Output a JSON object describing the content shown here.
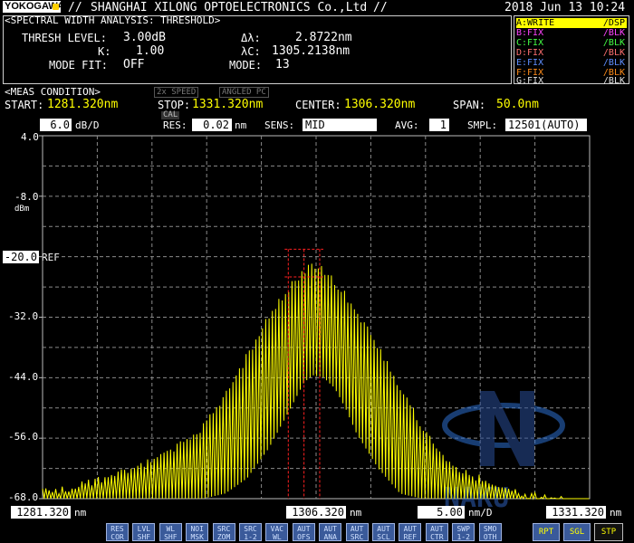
{
  "header": {
    "brand": "YOKOGAWA",
    "separator": "//",
    "company": "SHANGHAI XILONG OPTOELECTRONICS Co.,Ltd",
    "separator_end": "//",
    "datetime": "2018 Jun 13 10:24"
  },
  "analysis": {
    "title": "<SPECTRAL WIDTH ANALYSIS: THRESHOLD>",
    "thresh_label": "THRESH LEVEL:",
    "thresh_value": "3.00dB",
    "k_label": "K:",
    "k_value": "1.00",
    "mode_fit_label": "MODE FIT:",
    "mode_fit_value": "OFF",
    "dl_label": "Δλ:",
    "dl_value": "2.8722nm",
    "lc_label": "λC:",
    "lc_value": "1305.2138nm",
    "mode_label": "MODE:",
    "mode_value": "13"
  },
  "traces": [
    {
      "name": "A:WRITE",
      "state": "/DSP",
      "color": "#ffff00"
    },
    {
      "name": "B:FIX",
      "state": "/BLK",
      "color": "#ff44ff"
    },
    {
      "name": "C:FIX",
      "state": "/BLK",
      "color": "#44ff44"
    },
    {
      "name": "D:FIX",
      "state": "/BLK",
      "color": "#ff7070"
    },
    {
      "name": "E:FIX",
      "state": "/BLK",
      "color": "#5f8fff"
    },
    {
      "name": "F:FIX",
      "state": "/BLK",
      "color": "#ff8c1a"
    },
    {
      "name": "G:FIX",
      "state": "/BLK",
      "color": "#e0e0e0"
    }
  ],
  "meas": {
    "title": "<MEAS CONDITION>",
    "speed": "2x SPEED",
    "angled": "ANGLED PC",
    "start_label": "START:",
    "start_value": "1281.320nm",
    "stop_label": "STOP:",
    "stop_value": "1331.320nm",
    "center_label": "CENTER:",
    "center_value": "1306.320nm",
    "span_label": "SPAN:",
    "span_value": "50.0nm"
  },
  "settings": {
    "scale_value": "6.0",
    "scale_unit": "dB/D",
    "cal_label": "CAL",
    "res_label": "RES:",
    "res_value": "0.02",
    "res_unit": "nm",
    "sens_label": "SENS:",
    "sens_value": "MID",
    "avg_label": "AVG:",
    "avg_value": "1",
    "smpl_label": "SMPL:",
    "smpl_value": "12501(AUTO)"
  },
  "axis": {
    "y_unit": "dBm",
    "ref_value": "-20.0",
    "ref_label": "REF",
    "y_ticks": [
      "4.0",
      "-8.0",
      "-20.0",
      "-32.0",
      "-44.0",
      "-56.0",
      "-68.0"
    ],
    "x_start": "1281.320",
    "x_center": "1306.320",
    "x_stop": "1331.320",
    "x_unit": "nm",
    "x_div_value": "5.00",
    "x_div_unit": "nm/D"
  },
  "softkeys": [
    {
      "l1": "RES",
      "l2": "COR"
    },
    {
      "l1": "LVL",
      "l2": "SHF"
    },
    {
      "l1": "WL",
      "l2": "SHF"
    },
    {
      "l1": "NOI",
      "l2": "MSK"
    },
    {
      "l1": "SRC",
      "l2": "ZOM"
    },
    {
      "l1": "SRC",
      "l2": "1-2"
    },
    {
      "l1": "VAC",
      "l2": "WL"
    },
    {
      "l1": "AUT",
      "l2": "OFS"
    },
    {
      "l1": "AUT",
      "l2": "ANA"
    },
    {
      "l1": "AUT",
      "l2": "SRC"
    },
    {
      "l1": "AUT",
      "l2": "SCL"
    },
    {
      "l1": "AUT",
      "l2": "REF"
    },
    {
      "l1": "AUT",
      "l2": "CTR"
    },
    {
      "l1": "SWP",
      "l2": "1-2"
    },
    {
      "l1": "SMO",
      "l2": "OTH"
    }
  ],
  "sweep_buttons": {
    "rpt": "RPT",
    "sgl": "SGL",
    "stp": "STP"
  },
  "watermark": {
    "text": "NAKU"
  },
  "colors": {
    "trace": "#ffff00",
    "grid": "#8a8a8a",
    "marker": "#ff2020",
    "panel_border": "#cfcfcf",
    "softkey": "#3a5a9a"
  },
  "chart_data": {
    "type": "line",
    "xlabel": "nm",
    "ylabel": "dBm",
    "xlim": [
      1281.32,
      1331.32
    ],
    "ylim": [
      -68.0,
      4.0
    ],
    "x_center": 1306.32,
    "grid": true,
    "series": [
      {
        "name": "A:WRITE",
        "envelope": {
          "x": [
            1281.32,
            1284,
            1287,
            1290,
            1293,
            1296,
            1298,
            1300,
            1302,
            1304,
            1305.2,
            1306,
            1307,
            1308,
            1309,
            1310,
            1312,
            1314,
            1316,
            1318,
            1320,
            1323,
            1326,
            1329,
            1331.32
          ],
          "peak": [
            -66,
            -65,
            -63,
            -61,
            -58,
            -53,
            -47,
            -39,
            -31,
            -25,
            -22,
            -21,
            -22,
            -24,
            -27,
            -30,
            -37,
            -45,
            -53,
            -59,
            -62,
            -65,
            -66.5,
            -67.5,
            -68
          ],
          "floor": [
            -68,
            -68,
            -68,
            -68,
            -68,
            -68,
            -67,
            -64,
            -58,
            -50,
            -45,
            -43.5,
            -44,
            -46,
            -50,
            -55,
            -62,
            -67,
            -68,
            -68,
            -68,
            -68,
            -68,
            -68,
            -68
          ]
        },
        "mode_spacing_nm": 0.3
      }
    ],
    "markers": {
      "lambda_c": 1305.2138,
      "delta_lambda": 2.8722,
      "threshold_db": 3.0
    }
  }
}
